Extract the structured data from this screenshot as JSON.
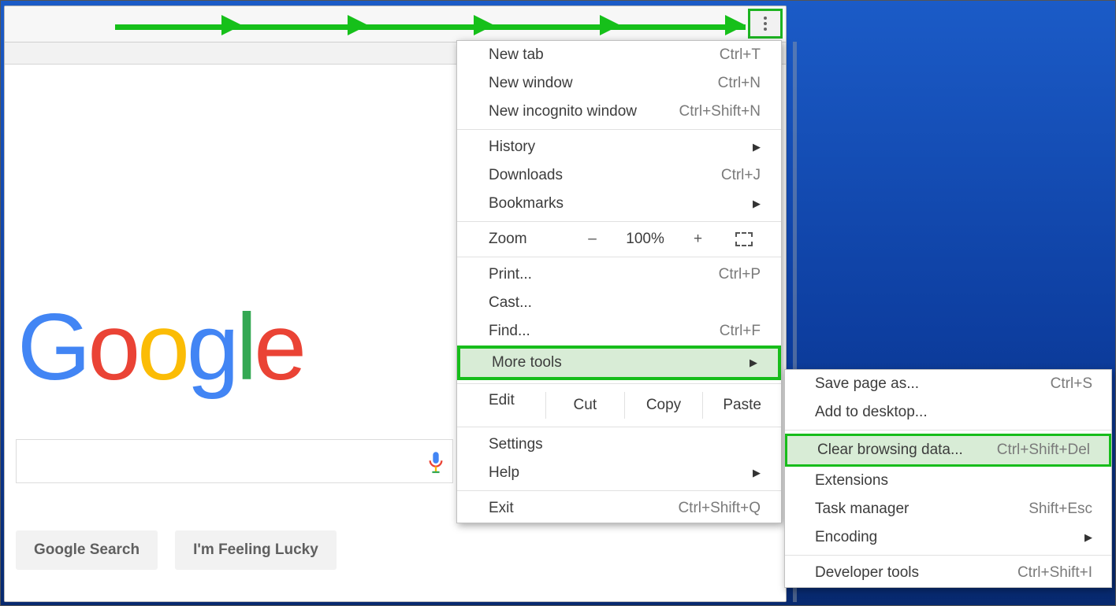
{
  "page": {
    "logo_letters": [
      "G",
      "o",
      "o",
      "g",
      "l",
      "e"
    ],
    "search_button": "Google Search",
    "lucky_button": "I'm Feeling Lucky"
  },
  "menu": {
    "group1": [
      {
        "label": "New tab",
        "shortcut": "Ctrl+T"
      },
      {
        "label": "New window",
        "shortcut": "Ctrl+N"
      },
      {
        "label": "New incognito window",
        "shortcut": "Ctrl+Shift+N"
      }
    ],
    "group2": [
      {
        "label": "History",
        "submenu": true
      },
      {
        "label": "Downloads",
        "shortcut": "Ctrl+J"
      },
      {
        "label": "Bookmarks",
        "submenu": true
      }
    ],
    "zoom": {
      "label": "Zoom",
      "value": "100%",
      "minus": "–",
      "plus": "+"
    },
    "group3": [
      {
        "label": "Print...",
        "shortcut": "Ctrl+P"
      },
      {
        "label": "Cast..."
      },
      {
        "label": "Find...",
        "shortcut": "Ctrl+F"
      },
      {
        "label": "More tools",
        "submenu": true,
        "highlight": true
      }
    ],
    "edit": {
      "label": "Edit",
      "cut": "Cut",
      "copy": "Copy",
      "paste": "Paste"
    },
    "group4": [
      {
        "label": "Settings"
      },
      {
        "label": "Help",
        "submenu": true
      }
    ],
    "group5": [
      {
        "label": "Exit",
        "shortcut": "Ctrl+Shift+Q"
      }
    ]
  },
  "submenu": {
    "items": [
      {
        "label": "Save page as...",
        "shortcut": "Ctrl+S"
      },
      {
        "label": "Add to desktop..."
      },
      {
        "sep": true
      },
      {
        "label": "Clear browsing data...",
        "shortcut": "Ctrl+Shift+Del",
        "highlight": true
      },
      {
        "label": "Extensions"
      },
      {
        "label": "Task manager",
        "shortcut": "Shift+Esc"
      },
      {
        "label": "Encoding",
        "submenu": true
      },
      {
        "sep": true
      },
      {
        "label": "Developer tools",
        "shortcut": "Ctrl+Shift+I"
      }
    ]
  }
}
